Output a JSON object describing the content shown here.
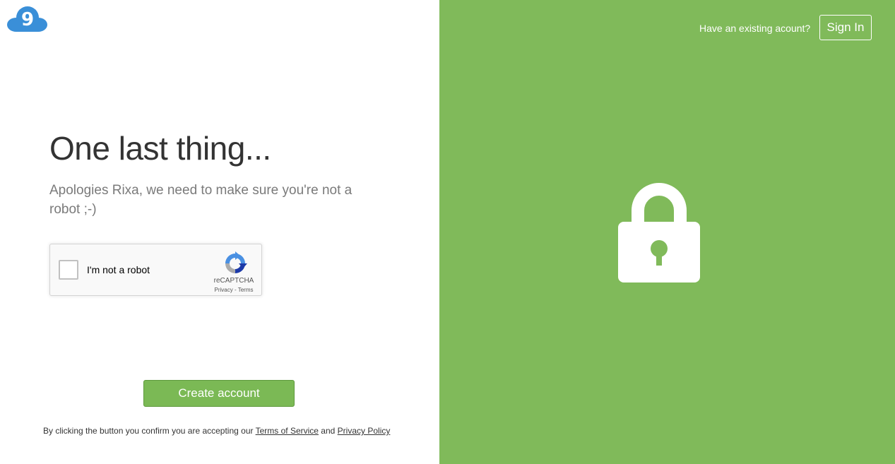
{
  "brand": {
    "logo_icon": "cloud-nine-logo",
    "logo_digit": "9",
    "logo_color": "#3a8fd8"
  },
  "main": {
    "headline": "One last thing...",
    "subtitle": "Apologies Rixa, we need to make sure you're not a robot ;-)"
  },
  "recaptcha": {
    "checkbox_label": "I'm not a robot",
    "brand": "reCAPTCHA",
    "privacy_link": "Privacy",
    "separator": " - ",
    "terms_link": "Terms",
    "checked": false
  },
  "actions": {
    "create_account_label": "Create account",
    "button_color": "#7bb955"
  },
  "legal": {
    "prefix": "By clicking the button you confirm you are accepting our ",
    "terms_link": "Terms of Service",
    "joiner": " and ",
    "privacy_link": "Privacy Policy"
  },
  "side_panel": {
    "existing_account_text": "Have an existing acount?",
    "sign_in_label": "Sign In",
    "background_color": "#80ba5a",
    "illustration_icon": "padlock-icon"
  }
}
